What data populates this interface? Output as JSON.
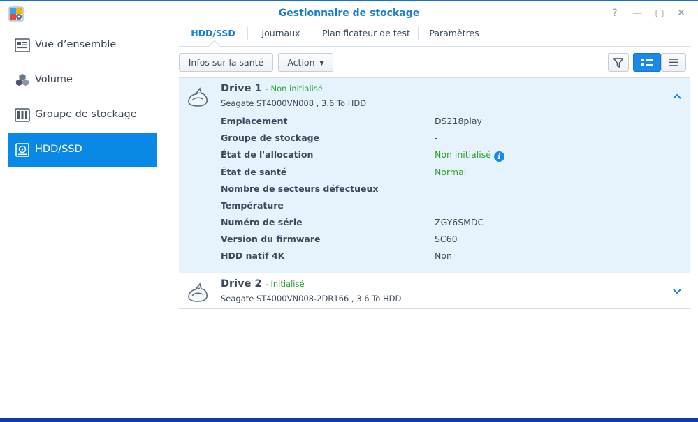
{
  "window": {
    "title": "Gestionnaire de stockage",
    "controls": {
      "help": "?",
      "minimize": "—",
      "maximize": "▢",
      "close": "✕"
    }
  },
  "sidebar": {
    "items": [
      {
        "label": "Vue d’ensemble",
        "icon": "overview-icon",
        "active": false
      },
      {
        "label": "Volume",
        "icon": "volume-cubes-icon",
        "active": false
      },
      {
        "label": "Groupe de stockage",
        "icon": "storage-pool-icon",
        "active": false
      },
      {
        "label": "HDD/SSD",
        "icon": "hdd-icon",
        "active": true
      }
    ]
  },
  "tabs": [
    {
      "label": "HDD/SSD",
      "active": true
    },
    {
      "label": "Journaux",
      "active": false
    },
    {
      "label": "Planificateur de test",
      "active": false
    },
    {
      "label": "Paramètres",
      "active": false
    }
  ],
  "toolbar": {
    "health_info_label": "Infos sur la santé",
    "action_label": "Action",
    "filter_icon": "filter-icon",
    "detail_view_icon": "detail-view-icon",
    "list_view_icon": "list-view-icon"
  },
  "drives": [
    {
      "name": "Drive 1",
      "status": "- Non initialisé",
      "description": "Seagate ST4000VN008 , 3.6 To HDD",
      "expanded": true,
      "properties": [
        {
          "label": "Emplacement",
          "value": "DS218play",
          "color": "default"
        },
        {
          "label": "Groupe de stockage",
          "value": "-",
          "color": "default"
        },
        {
          "label": "État de l'allocation",
          "value": "Non initialisé",
          "color": "green",
          "info": true
        },
        {
          "label": "État de santé",
          "value": "Normal",
          "color": "green"
        },
        {
          "label": "Nombre de secteurs défectueux",
          "value": "",
          "color": "default"
        },
        {
          "label": "Température",
          "value": "-",
          "color": "default"
        },
        {
          "label": "Numéro de série",
          "value": "ZGY6SMDC",
          "color": "default"
        },
        {
          "label": "Version du firmware",
          "value": "SC60",
          "color": "default"
        },
        {
          "label": "HDD natif 4K",
          "value": "Non",
          "color": "default"
        }
      ]
    },
    {
      "name": "Drive 2",
      "status": "- Initialisé",
      "description": "Seagate ST4000VN008-2DR166 , 3.6 To HDD",
      "expanded": false
    }
  ],
  "colors": {
    "accent": "#0a88e6",
    "title": "#1a7ed6",
    "status_green": "#2fa32f",
    "expanded_bg": "#e6f3fc"
  }
}
